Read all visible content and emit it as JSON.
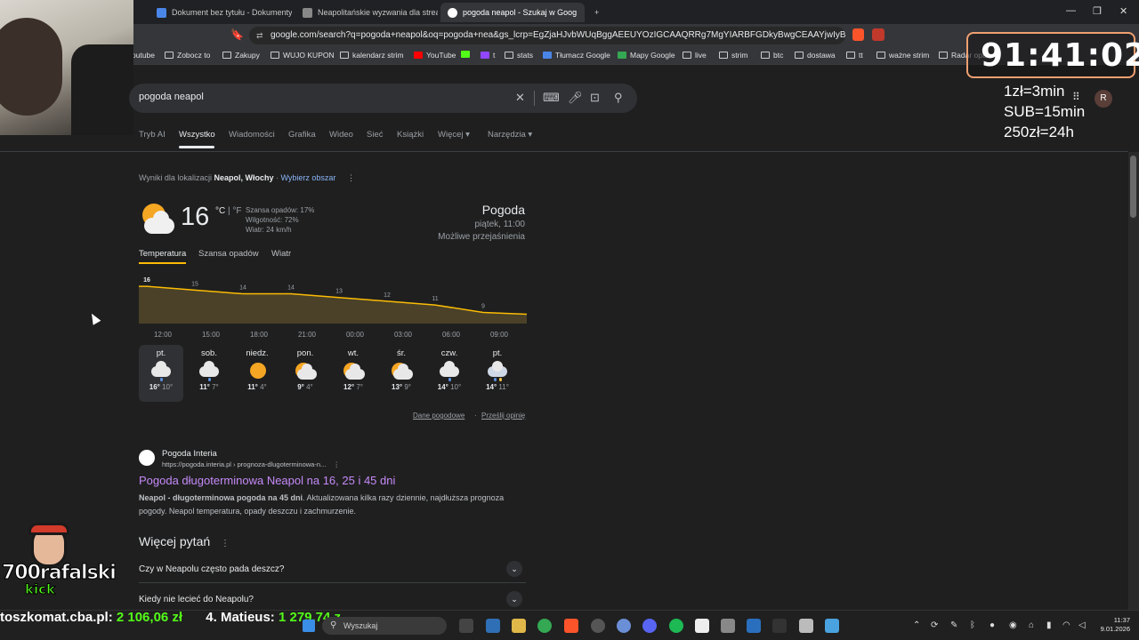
{
  "browser": {
    "tabs": [
      {
        "label": "Dokument bez tytułu - Dokumenty G"
      },
      {
        "label": "Neapolitańskie wyzwania dla stream"
      },
      {
        "label": "pogoda neapol - Szukaj w Goog"
      }
    ],
    "new_tab": "+",
    "url": "google.com/search?q=pogoda+neapol&oq=pogoda+nea&gs_lcrp=EgZjaHJvbWUqBggAEEUYOzIGCAAQRRg7MgYIARBFGDkyBwgCEAAYjwIyBggDEE...",
    "bookmarks": [
      "outube",
      "Zobocz to",
      "Zakupy",
      "WUJO KUPON",
      "kalendarz strim",
      "YouTube",
      "t",
      "stats",
      "Tłumacz Google",
      "Mapy Google",
      "live",
      "strim",
      "btc",
      "dostawa",
      "tt",
      "ważne strim",
      "Radar opa"
    ]
  },
  "search": {
    "query": "pogoda neapol",
    "tabs": [
      "Tryb AI",
      "Wszystko",
      "Wiadomości",
      "Grafika",
      "Wideo",
      "Sieć",
      "Książki",
      "Więcej",
      "Narzędzia"
    ]
  },
  "weather": {
    "location_prefix": "Wyniki dla lokalizacji",
    "location": "Neapol, Włochy",
    "change_area": "Wybierz obszar",
    "temp": "16",
    "unit_c": "°C",
    "unit_sep": "|",
    "unit_f": "°F",
    "precip": "Szansa opadów: 17%",
    "humidity": "Wilgotność: 72%",
    "wind": "Wiatr: 24 km/h",
    "title": "Pogoda",
    "datetime": "piątek, 11:00",
    "condition": "Możliwe przejaśnienia",
    "tabs": [
      "Temperatura",
      "Szansa opadów",
      "Wiatr"
    ],
    "days": [
      {
        "name": "pt.",
        "hi": "16°",
        "lo": "10°",
        "icon": "cloud-rain"
      },
      {
        "name": "sob.",
        "hi": "11°",
        "lo": "7°",
        "icon": "cloud-rain"
      },
      {
        "name": "niedz.",
        "hi": "11°",
        "lo": "4°",
        "icon": "sun"
      },
      {
        "name": "pon.",
        "hi": "9°",
        "lo": "4°",
        "icon": "sun-cloud"
      },
      {
        "name": "wt.",
        "hi": "12°",
        "lo": "7°",
        "icon": "sun-cloud"
      },
      {
        "name": "śr.",
        "hi": "13°",
        "lo": "9°",
        "icon": "sun-cloud"
      },
      {
        "name": "czw.",
        "hi": "14°",
        "lo": "10°",
        "icon": "cloud-rain"
      },
      {
        "name": "pt.",
        "hi": "14°",
        "lo": "11°",
        "icon": "storm"
      }
    ],
    "footer_data": "Dane pogodowe",
    "footer_feedback": "Prześlij opinię"
  },
  "chart_data": {
    "type": "area",
    "x": [
      "12:00",
      "15:00",
      "18:00",
      "21:00",
      "00:00",
      "03:00",
      "06:00",
      "09:00"
    ],
    "series": [
      {
        "values": [
          16,
          15,
          14,
          14,
          13,
          12,
          11,
          9
        ]
      }
    ],
    "labels": [
      "16",
      "15",
      "14",
      "14",
      "13",
      "12",
      "11",
      "9"
    ],
    "color": "#fbbc04"
  },
  "result": {
    "site": "Pogoda Interia",
    "url": "https://pogoda.interia.pl › prognoza-dlugoterminowa-n...",
    "title": "Pogoda długoterminowa Neapol na 16, 25 i 45 dni",
    "snippet_bold": "Neapol - długoterminowa pogoda na 45 dni",
    "snippet_rest": ". Aktualizowana kilka razy dziennie, najdłuższa prognoza pogody. Neapol temperatura, opady deszczu i zachmurzenie."
  },
  "paa": {
    "title": "Więcej pytań",
    "questions": [
      "Czy w Neapolu często pada deszcz?",
      "Kiedy nie lecieć do Neapolu?"
    ]
  },
  "overlay": {
    "timer": "91:41:02",
    "rates": [
      "1zł=3min",
      "SUB=15min",
      "250zł=24h"
    ],
    "avatar": "R",
    "logo_name": "700rafalski",
    "logo_kick": "kick",
    "ticker_prefix": "toszkomat.cba.pl:",
    "ticker_amount1": "2 106,06 zł",
    "ticker_mid": "4. Matieus:",
    "ticker_amount2": "1 279,74 z"
  },
  "taskbar": {
    "search_placeholder": "Wyszukaj",
    "time": "11:37",
    "date": "9.01.2026"
  }
}
